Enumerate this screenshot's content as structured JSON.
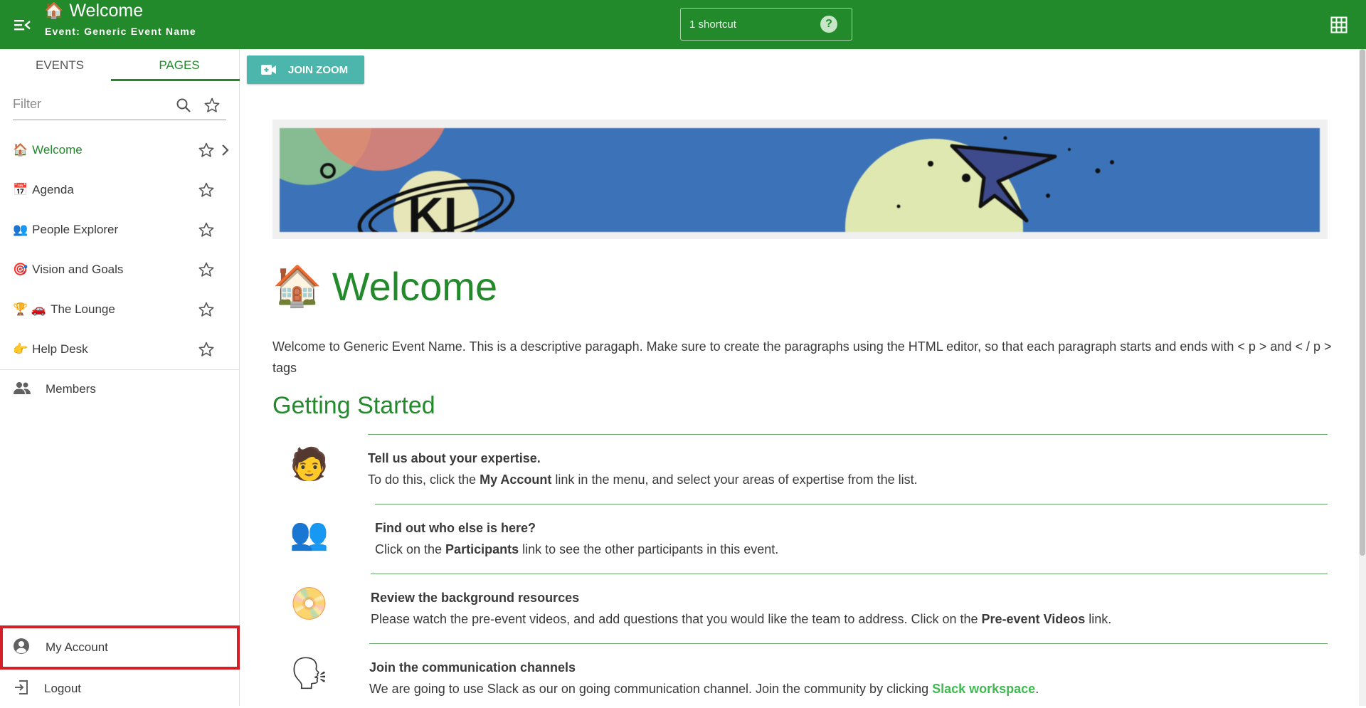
{
  "header": {
    "title": "Welcome",
    "title_emoji": "🏠",
    "subtitle": "Event: Generic Event Name",
    "shortcut_label": "1 shortcut",
    "help_glyph": "?"
  },
  "sidebar": {
    "tabs": [
      {
        "label": "EVENTS"
      },
      {
        "label": "PAGES"
      }
    ],
    "active_tab": "PAGES",
    "filter_placeholder": "Filter",
    "items": [
      {
        "emoji": "🏠",
        "label": "Welcome",
        "active": true
      },
      {
        "emoji": "📅",
        "label": "Agenda"
      },
      {
        "emoji": "👥",
        "label": "People Explorer"
      },
      {
        "emoji": "🎯",
        "label": "Vision and Goals"
      },
      {
        "emoji": "🏆 🚗",
        "label": "The Lounge"
      },
      {
        "emoji": "👉",
        "label": "Help Desk"
      }
    ],
    "members_label": "Members",
    "my_account_label": "My Account",
    "logout_label": "Logout"
  },
  "main": {
    "zoom_button_label": "JOIN ZOOM",
    "heading_emoji": "🏠",
    "heading": "Welcome",
    "intro": "Welcome to Generic Event Name. This is a descriptive paragaph. Make sure to create the paragraphs using the HTML editor, so that each paragraph starts and ends with < p > and < / p > tags",
    "section_heading": "Getting Started",
    "steps": [
      {
        "icon": "🧑",
        "title": "Tell us about your expertise.",
        "desc_before": "To do this, click the ",
        "desc_bold": "My Account",
        "desc_after": " link in the menu, and select your areas of expertise from the list."
      },
      {
        "icon": "👥",
        "title": "Find out who else is here?",
        "desc_before": "Click on the ",
        "desc_bold": "Participants",
        "desc_after": " link to see the other participants in this event."
      },
      {
        "icon": "📀",
        "title": "Review the background resources",
        "desc_before": "Please watch the pre-event videos, and add questions that you would like the team to address. Click on the ",
        "desc_bold": "Pre-event Videos",
        "desc_after": " link."
      },
      {
        "icon": "🗣",
        "title": "Join the communication channels",
        "desc_before": "We are going to use Slack as our on going communication channel. Join the community by clicking ",
        "desc_link": "Slack workspace",
        "desc_after": "."
      }
    ]
  },
  "colors": {
    "brand_green": "#238a2c",
    "zoom_teal": "#4db6ac",
    "highlight_red": "#d32027",
    "link_green": "#3fb950",
    "banner_blue": "#3c73b8"
  }
}
